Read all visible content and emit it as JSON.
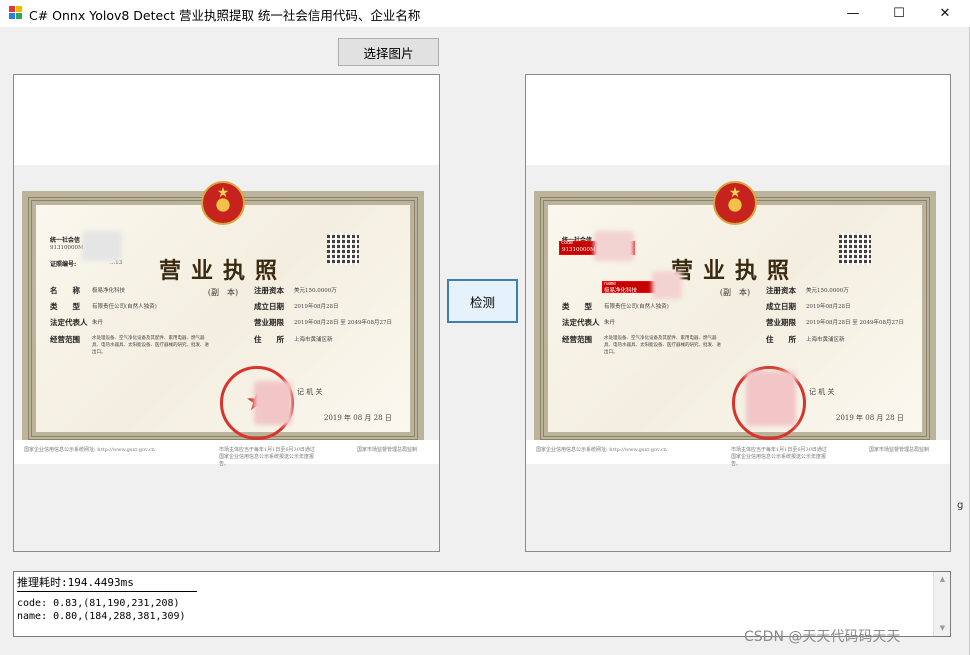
{
  "window": {
    "title": "C# Onnx Yolov8 Detect 营业执照提取 统一社会信用代码、企业名称",
    "controls": {
      "minimize": "—",
      "maximize": "☐",
      "close": "✕"
    },
    "app_icon_colors": [
      "#e23b2e",
      "#f5b800",
      "#2b7be4",
      "#30a84b"
    ]
  },
  "toolbar": {
    "select_image_label": "选择图片"
  },
  "detect_button_label": "检测",
  "license": {
    "title": "营业执照",
    "subtitle": "(副　本)",
    "credit_code_label": "统一社会信",
    "credit_code_value": "91310000M...",
    "cert_no_label": "证照编号:",
    "cert_no_value": "...13",
    "fields_left": [
      {
        "label": "名　　称",
        "value": "极易净化科技"
      },
      {
        "label": "类　　型",
        "value": "有限责任公司(自然人独资)"
      },
      {
        "label": "法定代表人",
        "value": "朱丹"
      },
      {
        "label": "经营范围",
        "value": "水处理设备、空气净化设备及其配件、家用电器、燃气器具、电热水器具、太阳能设备、医疗器械的研究、批发、进出口。"
      }
    ],
    "fields_right": [
      {
        "label": "注册资本",
        "value": "美元150.0000万"
      },
      {
        "label": "成立日期",
        "value": "2019年08月28日"
      },
      {
        "label": "营业期限",
        "value": "2019年08月28日 至 2049年08月27日"
      },
      {
        "label": "住　　所",
        "value": "上海市黄浦区新"
      }
    ],
    "registrar": "记 机 关",
    "issue_date": "2019 年 08 月 28 日",
    "footer_left": "国家企业信用信息公示系统网址: http://www.gsxt.gov.cn",
    "footer_mid": "市场主体应当于每年1月1日至6月30日通过国家企业信用信息公示系统报送公示年度报告。",
    "footer_right": "国家市场监督管理总局监制"
  },
  "detections": [
    {
      "label": "code",
      "confidence": "0.83"
    },
    {
      "label": "name",
      "confidence": "0.80"
    }
  ],
  "output": {
    "line1": "推理耗时:194.4493ms",
    "line2": "code: 0.83,(81,190,231,208)",
    "line3": "name: 0.80,(184,288,381,309)"
  },
  "watermark": "CSDN @天天代码码天天",
  "side_text": "g"
}
